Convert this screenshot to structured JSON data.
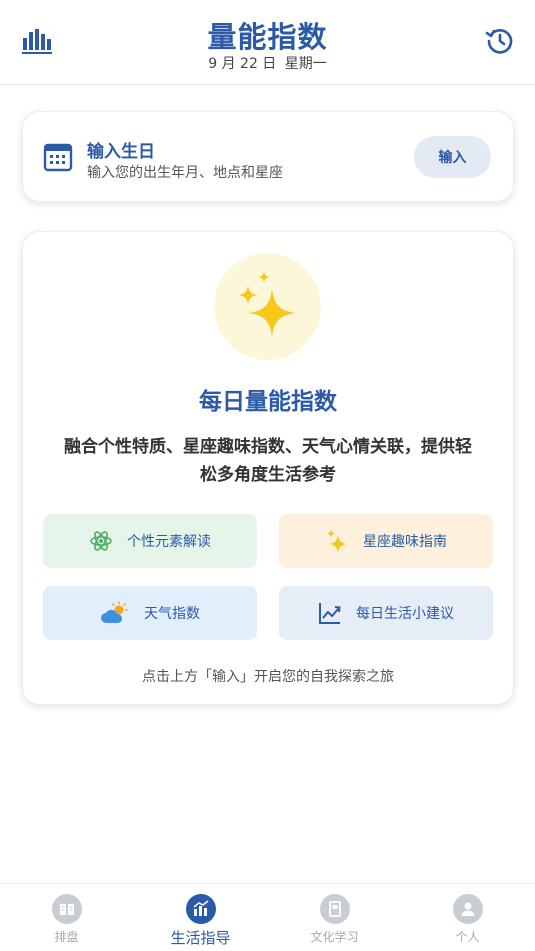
{
  "header": {
    "title": "量能指数",
    "date_month": "9 月 22 日",
    "date_weekday": "星期一",
    "left_icon": "bar-chart-icon",
    "right_icon": "history-icon"
  },
  "input_card": {
    "title": "输入生日",
    "subtitle": "输入您的出生年月、地点和星座",
    "button_label": "输入",
    "icon": "calendar-icon"
  },
  "main_card": {
    "icon": "sparkles-icon",
    "title": "每日量能指数",
    "description": "融合个性特质、星座趣味指数、天气心情关联，提供轻松多角度生活参考",
    "features": [
      {
        "label": "个性元素解读",
        "icon": "atom-icon"
      },
      {
        "label": "星座趣味指南",
        "icon": "sparkle-icon"
      },
      {
        "label": "天气指数",
        "icon": "weather-icon"
      },
      {
        "label": "每日生活小建议",
        "icon": "trend-chart-icon"
      }
    ],
    "hint": "点击上方「输入」开启您的自我探索之旅"
  },
  "tabbar": {
    "tabs": [
      {
        "label": "排盘",
        "icon": "book-icon",
        "active": false
      },
      {
        "label": "生活指导",
        "icon": "chart-icon",
        "active": true
      },
      {
        "label": "文化学习",
        "icon": "document-icon",
        "active": false
      },
      {
        "label": "个人",
        "icon": "person-icon",
        "active": false
      }
    ]
  },
  "colors": {
    "accent": "#2b5aa8",
    "sparkle": "#f7c71a"
  }
}
